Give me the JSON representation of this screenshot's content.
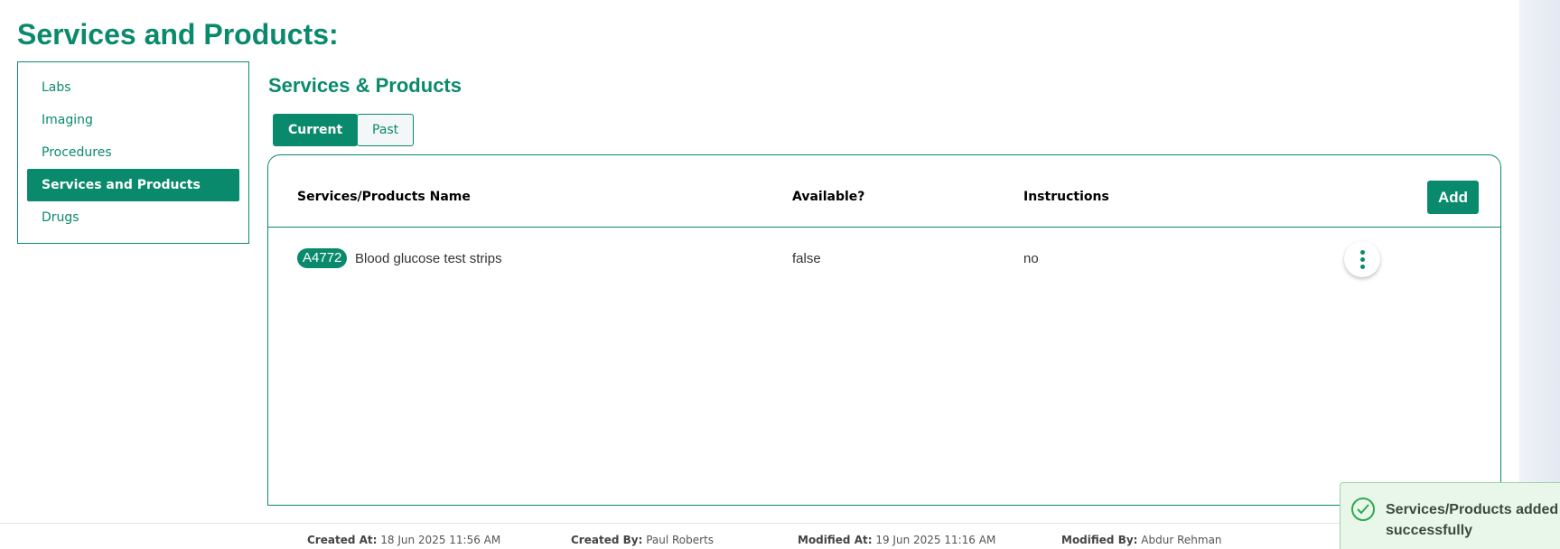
{
  "page": {
    "title": "Services and Products:"
  },
  "sidebar": {
    "items": [
      {
        "label": "Labs"
      },
      {
        "label": "Imaging"
      },
      {
        "label": "Procedures"
      },
      {
        "label": "Services and Products",
        "active": true
      },
      {
        "label": "Drugs"
      }
    ]
  },
  "main": {
    "title": "Services & Products",
    "tabs": [
      {
        "label": "Current",
        "active": true
      },
      {
        "label": "Past"
      }
    ],
    "table": {
      "headers": [
        "Services/Products Name",
        "Available?",
        "Instructions"
      ],
      "add_label": "Add",
      "rows": [
        {
          "code": "A4772",
          "name": "Blood glucose test strips",
          "available": "false",
          "instructions": "no"
        }
      ]
    }
  },
  "footer": {
    "created_at_label": "Created At:",
    "created_at": "18 Jun 2025 11:56 AM",
    "created_by_label": "Created By:",
    "created_by": "Paul Roberts",
    "modified_at_label": "Modified At:",
    "modified_at": "19 Jun 2025 11:16 AM",
    "modified_by_label": "Modified By:",
    "modified_by": "Abdur Rehman"
  },
  "toast": {
    "message": "Services/Products added successfully",
    "icon": "check-circle-icon"
  },
  "colors": {
    "accent": "#0a8a6c",
    "toast_bg": "#e9f7ea",
    "toast_icon": "#2fa84f"
  }
}
